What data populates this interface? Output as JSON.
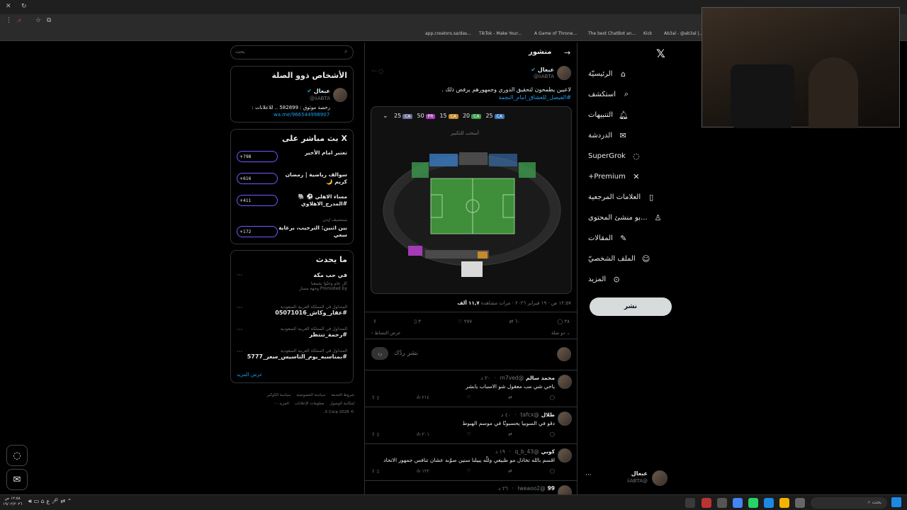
{
  "browser": {
    "bookmarks": [
      "app.creators.sa/das...",
      "TikTok - Make Your...",
      "A Game of Throne...",
      "The best ChatBot an...",
      "Kick",
      "Ab3al - @ab3al |..."
    ]
  },
  "nav": {
    "items": [
      {
        "label": "الرئيسيّة",
        "icon": "home-icon"
      },
      {
        "label": "استكشف",
        "icon": "search-icon"
      },
      {
        "label": "التنبيهات",
        "icon": "bell-icon"
      },
      {
        "label": "الدردشة",
        "icon": "mail-icon"
      },
      {
        "label": "SuperGrok",
        "icon": "grok-icon"
      },
      {
        "label": "Premium+",
        "icon": "x-icon"
      },
      {
        "label": "العلامات المرجعية",
        "icon": "bookmark-icon"
      },
      {
        "label": "...بو منشئ المحتوى",
        "icon": "creator-icon"
      },
      {
        "label": "المقالات",
        "icon": "article-icon"
      },
      {
        "label": "الملف الشخصيّ",
        "icon": "profile-icon"
      },
      {
        "label": "المزيد",
        "icon": "more-icon"
      }
    ],
    "post_button": "نشر",
    "account": {
      "name": "عبعال",
      "handle": "@iiABTA"
    }
  },
  "post": {
    "header": "منشور",
    "author_name": "عبعال",
    "author_handle": "@iiABTA",
    "text": "لاعبين يطمحون لتحقيق الدوري وجمهورهم يرفض ذلك .",
    "hashtag": "#الفيصل_للعشاق_امام_النجمة",
    "map_hint": "أسحب للتكبير",
    "price_tags": [
      "25",
      "20",
      "15",
      "50",
      "25"
    ],
    "price_codes": [
      "CA",
      "CA",
      "CA",
      "PR",
      "CA"
    ],
    "timestamp": "١٢:٥٧ ص · ١٩ فبراير ٢٠٢٦ · مرات مشاهدة",
    "views": "١١,٧ ألف",
    "stats": {
      "replies": "٣٨",
      "retweets": "٦٠",
      "likes": "٢٧٧",
      "bookmarks": "٣"
    },
    "more_replies": "ذو صلة",
    "activity": "عرض النشاط",
    "reply_placeholder": "نشر ردّك",
    "reply_button": "رد"
  },
  "replies": [
    {
      "name": "محمد سالم",
      "handle": "@m7ved",
      "time": "٢٠ د",
      "text": "ياخي شي مب معقول شو الاسباب يابشر",
      "views": "٢١٤"
    },
    {
      "name": "طلال",
      "handle": "@tafcx",
      "time": "٤٠ د",
      "text": "دقو في السوبيا يحسبونّا في موسم الهبوط",
      "views": "٢٠١"
    },
    {
      "name": "كوبي",
      "handle": "@q_b_43",
      "time": "١٩ د",
      "text": "اقسم بالله تخاذل مو طبيعي وللّه يبيلنا سنين صوّبه عشان تنافس جمهور الاتحاد",
      "views": "١٢٢"
    },
    {
      "name": "99",
      "handle": "@Iweaoo2",
      "time": "٢٦ د",
      "text": "",
      "views": ""
    }
  ],
  "sidebar": {
    "search_placeholder": "بحث",
    "related_title": "الأشخاص ذوو الصلة",
    "related": {
      "name": "عبعال",
      "handle": "@iiABTA",
      "bio": "رخصة موثوق : 582899 .. للاعلانات :",
      "link": "wa.me/966544998907"
    },
    "live_title": "X بث مباشر على",
    "spaces": [
      {
        "title": "تعتبر امام الأخير",
        "count": "+798"
      },
      {
        "title": "سوالف رياضية | رمضان كريم 🌙",
        "count": "+616"
      },
      {
        "title": "مساء الاهلي ⚽ 🐘#المدرج_الاهلاوي",
        "count": "+411"
      },
      {
        "title": "بين اثنين: الترحيب، برعاية سعي",
        "count": "+172"
      }
    ],
    "spaces_host": "يستضيف إيدن",
    "trends_title": "ما يحدث",
    "promo": {
      "title": "في حب مكة",
      "sub": "كل عام وحنّوا يجمعنا",
      "by": "Promoted by وجهة مسار"
    },
    "trends": [
      {
        "context": "المتداول في المملكة العربية السعودية",
        "name": "#عقار_وكاش_05071016"
      },
      {
        "context": "المتداول في المملكة العربية السعودية",
        "name": "#رحمة_تنتظر"
      },
      {
        "context": "المتداول في المملكة العربية السعودية",
        "name": "#بمناسبه_يوم_التاسيس_سعر_5777"
      }
    ],
    "show_more": "عرض المزيد",
    "footer": [
      "شروط الخدمة",
      "سياسة الخصوصية",
      "سياسة الكوكيز",
      "إمكانية الوصول",
      "معلومات الإعلانات",
      "المزيد ···",
      "© 2026 X Corp."
    ]
  },
  "taskbar": {
    "search": "بحث",
    "clock": "١٢:٥٨ ص",
    "date": "١٩/٠٢/٢٠٢٦"
  }
}
